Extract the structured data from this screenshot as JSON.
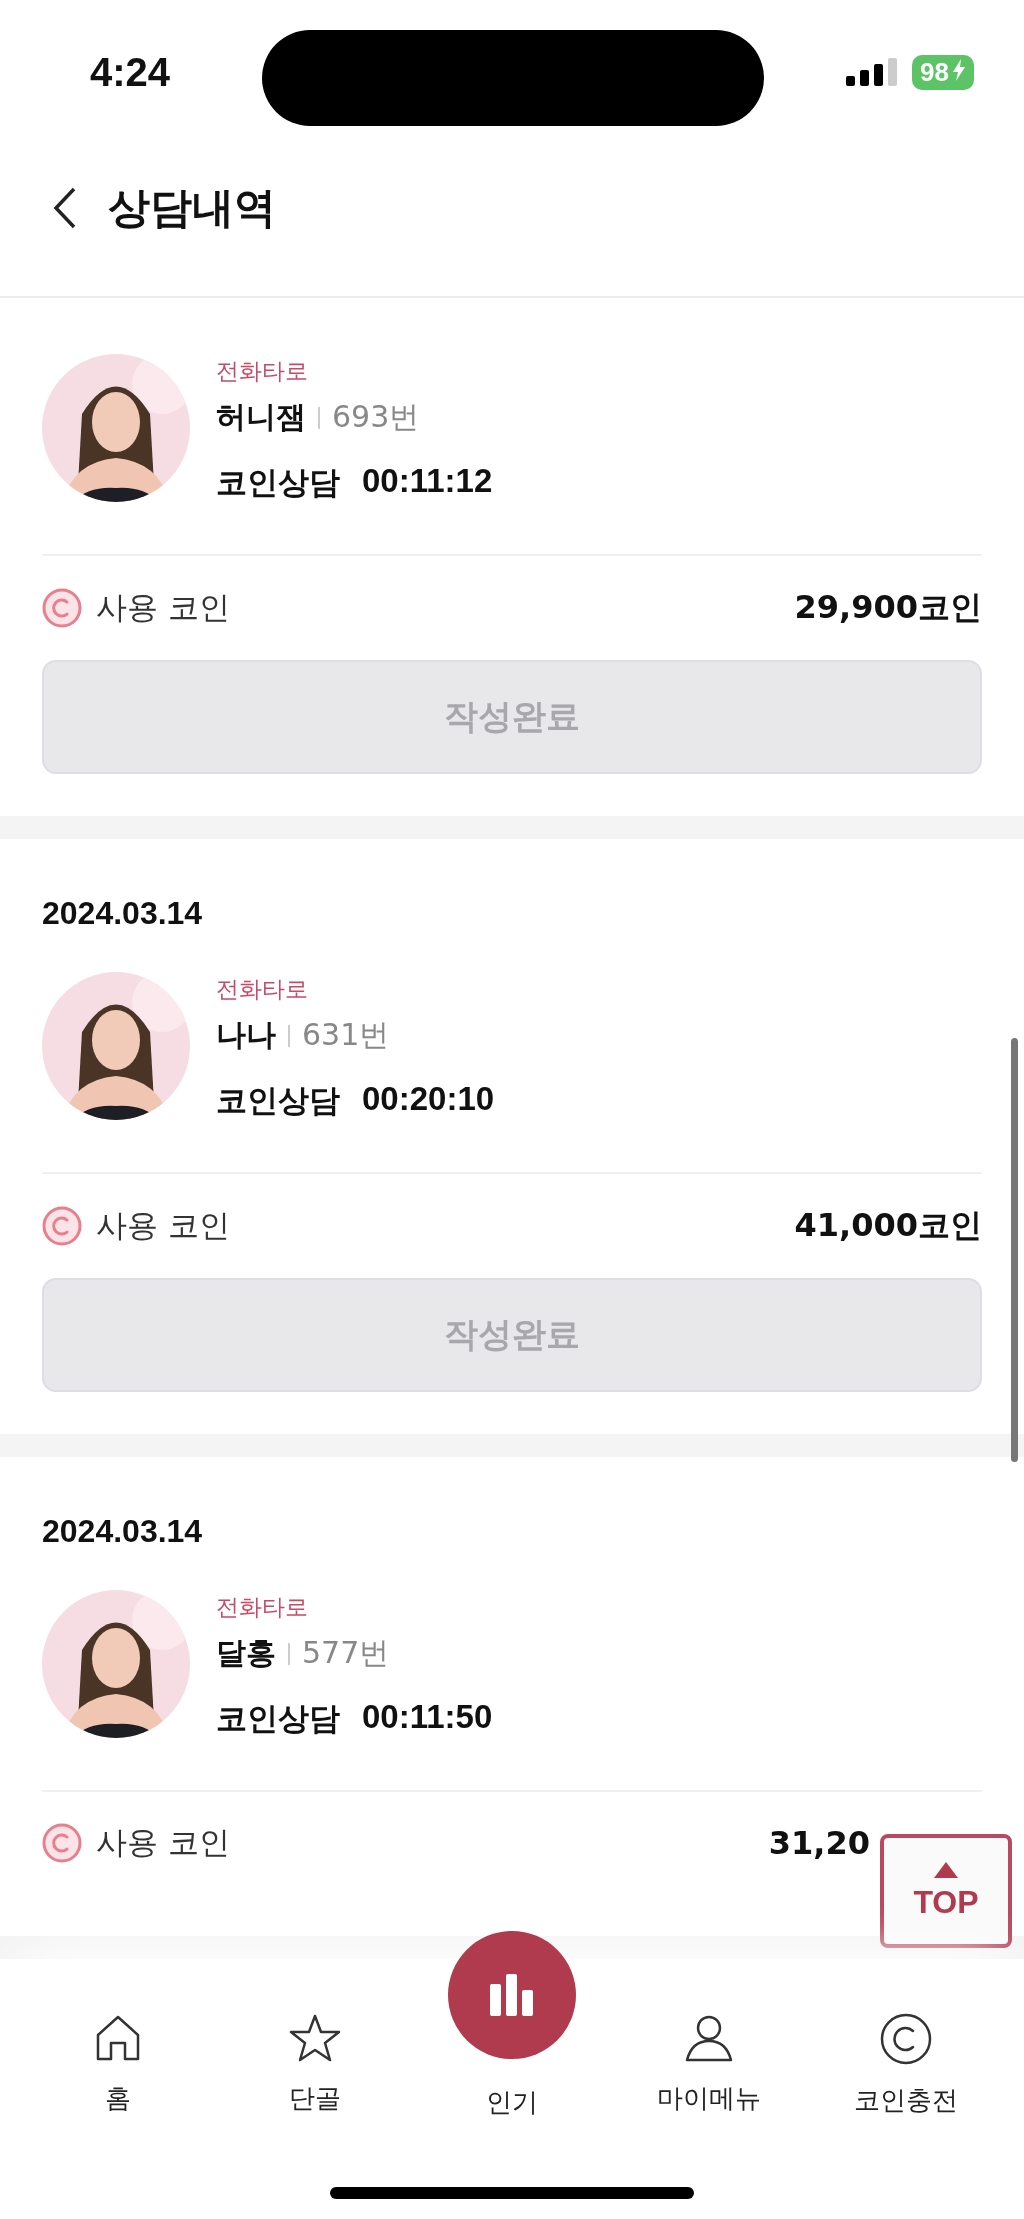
{
  "status_bar": {
    "time": "4:24",
    "battery": "98"
  },
  "header": {
    "title": "상담내역"
  },
  "records": [
    {
      "category": "전화타로",
      "name": "허니잼",
      "number": "693번",
      "type": "코인상담",
      "duration": "00:11:12",
      "coin_label": "사용 코인",
      "coin_amount": "29,900코인",
      "button": {
        "label": "작성완료",
        "disabled": true
      }
    },
    {
      "date": "2024.03.14",
      "category": "전화타로",
      "name": "나나",
      "number": "631번",
      "type": "코인상담",
      "duration": "00:20:10",
      "coin_label": "사용 코인",
      "coin_amount": "41,000코인",
      "button": {
        "label": "작성완료",
        "disabled": true
      }
    },
    {
      "date": "2024.03.14",
      "category": "전화타로",
      "name": "달홍",
      "number": "577번",
      "type": "코인상담",
      "duration": "00:11:50",
      "coin_label": "사용 코인",
      "coin_amount": "31,20"
    }
  ],
  "top_button": {
    "label": "TOP"
  },
  "tab_bar": {
    "items": [
      {
        "label": "홈",
        "kind": "home"
      },
      {
        "label": "단골",
        "kind": "star"
      },
      {
        "label": "인기",
        "kind": "popular"
      },
      {
        "label": "마이메뉴",
        "kind": "person"
      },
      {
        "label": "코인충전",
        "kind": "coin"
      }
    ]
  }
}
